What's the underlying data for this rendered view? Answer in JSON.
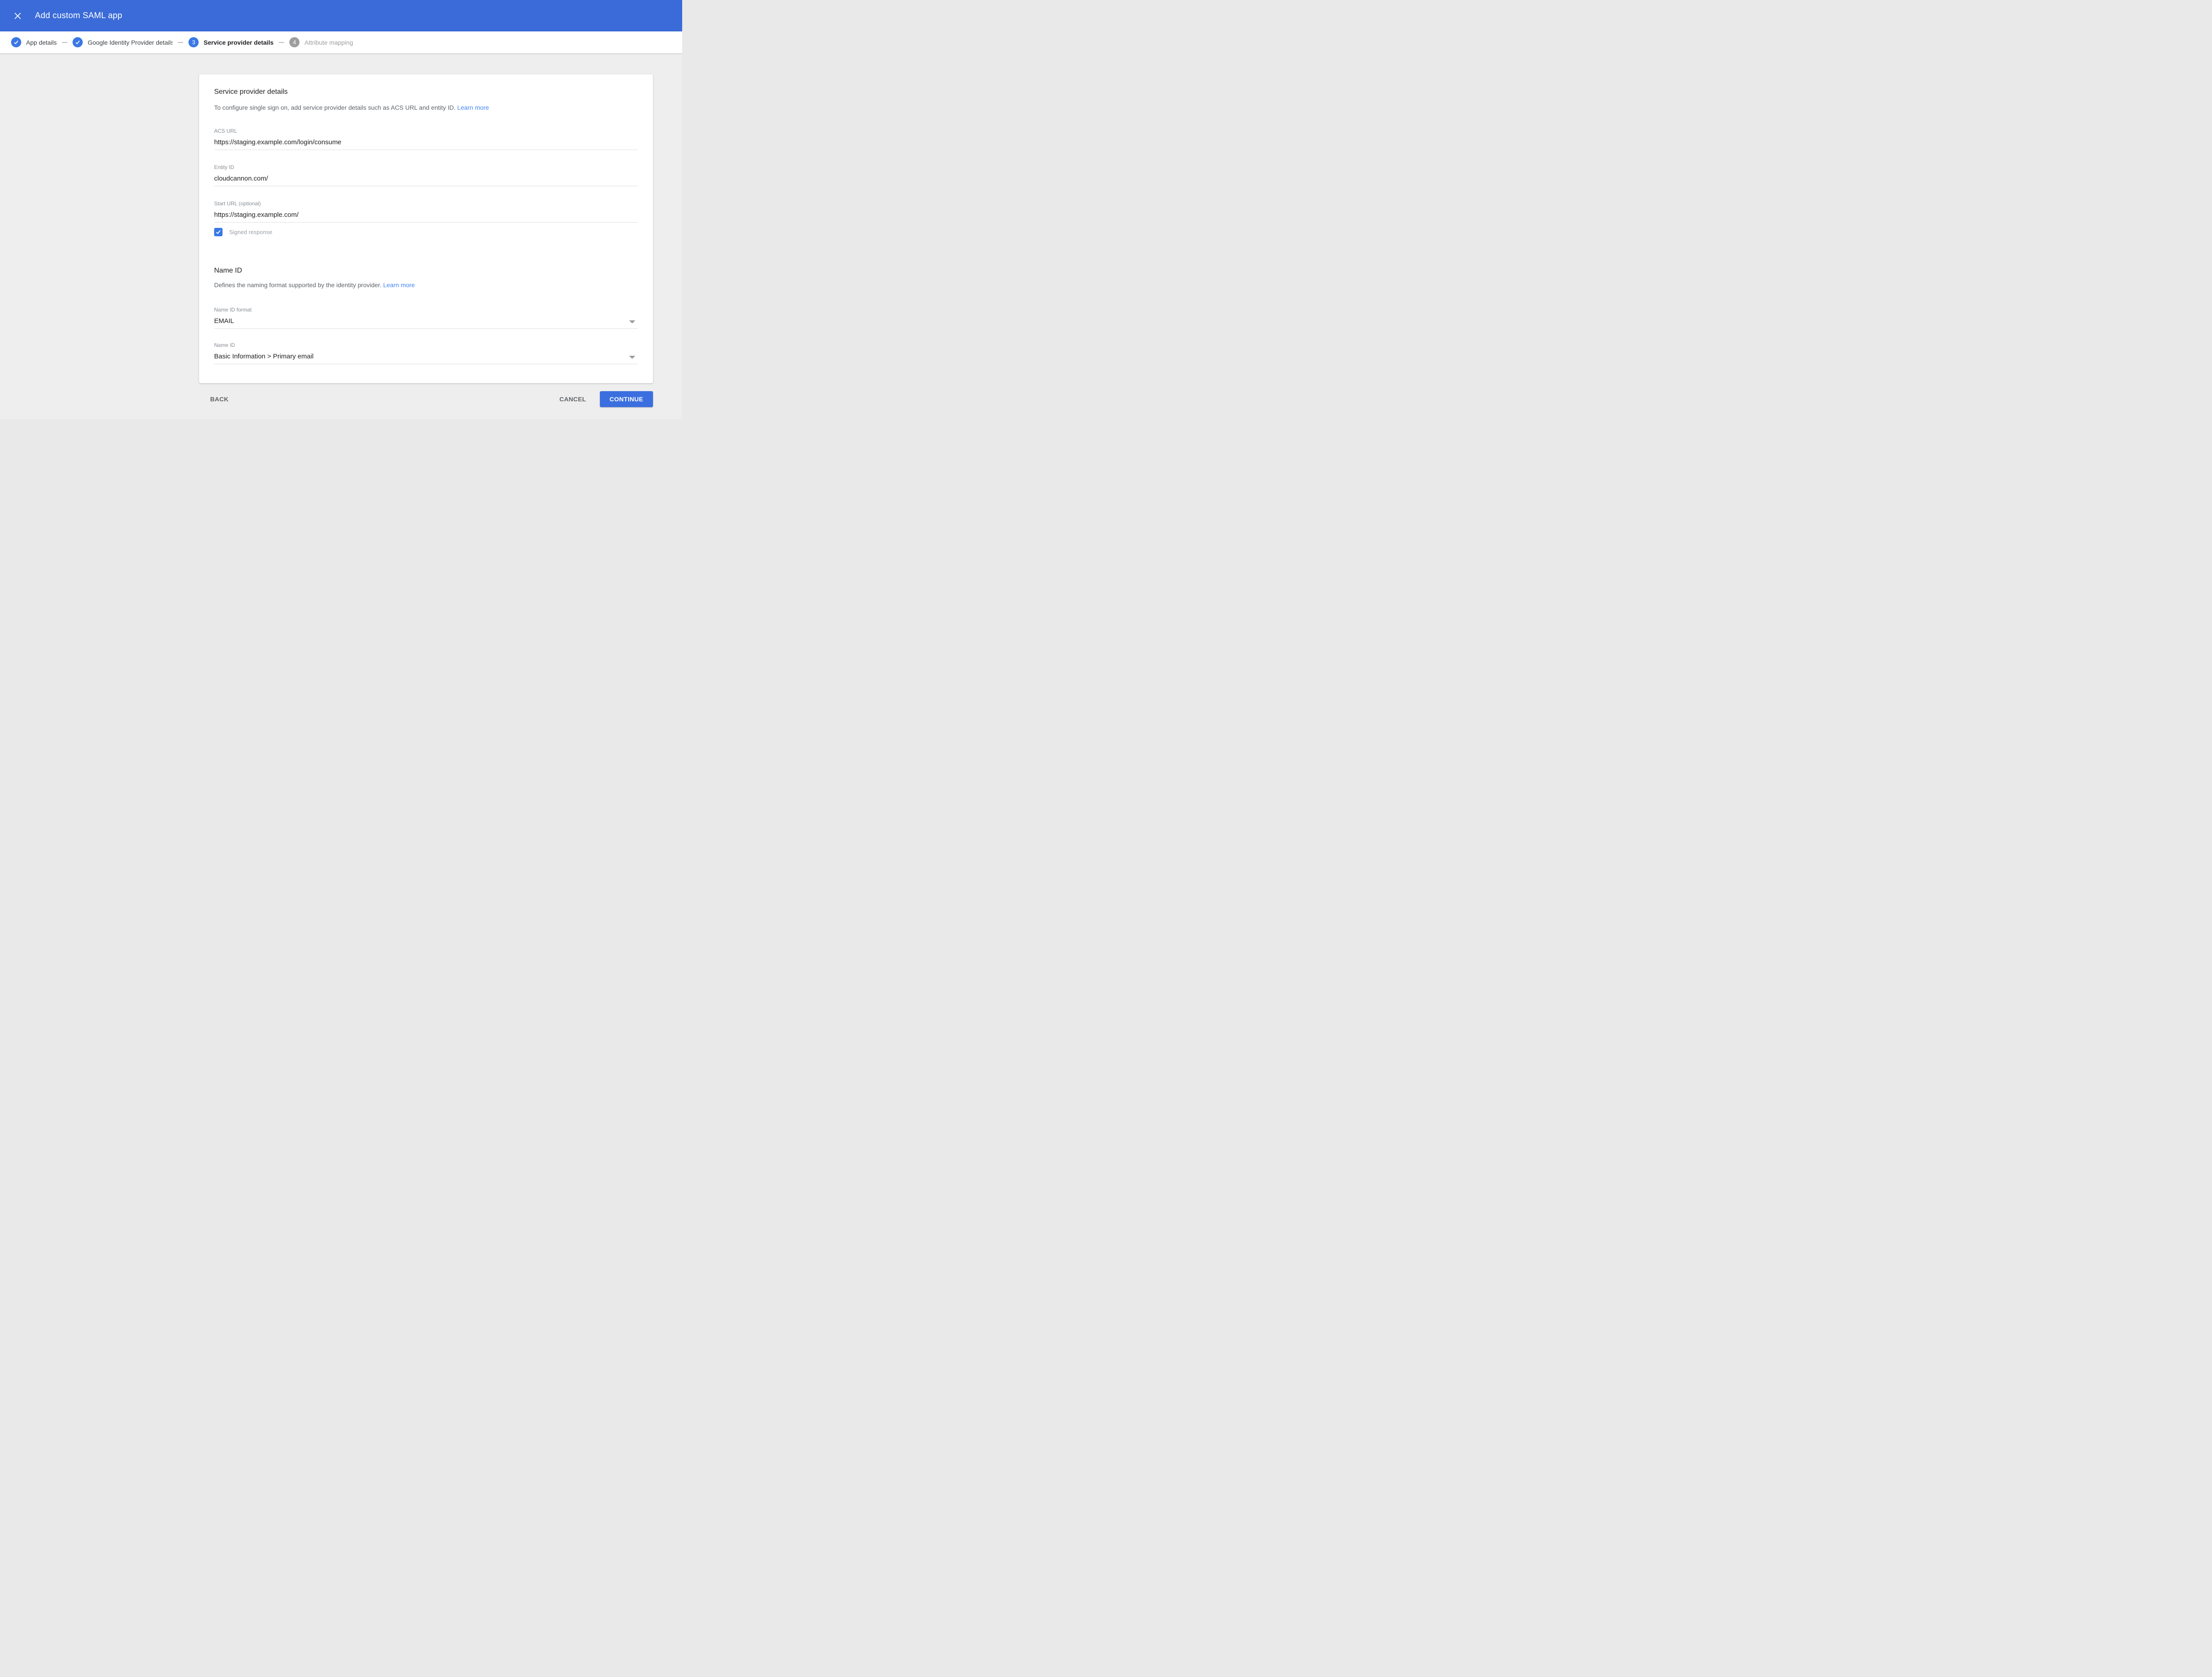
{
  "colors": {
    "topbar_blue": "#3a6bd8",
    "accent_blue": "#3b78e5",
    "continue_blue": "#3b6fe0",
    "link_blue": "#4285f4",
    "background_gray": "#eeeeee"
  },
  "topbar": {
    "title": "Add custom SAML app"
  },
  "stepper": {
    "steps": [
      {
        "label": "App details",
        "state": "complete"
      },
      {
        "label": "Google Identity Provider details",
        "state": "complete"
      },
      {
        "number": "3",
        "label": "Service provider details",
        "state": "current"
      },
      {
        "number": "4",
        "label": "Attribute mapping",
        "state": "upcoming"
      }
    ]
  },
  "service_provider_section": {
    "title": "Service provider details",
    "description": "To configure single sign on, add service provider details such as ACS URL and entity ID.",
    "learn_more_label": "Learn more"
  },
  "fields": {
    "acs_url": {
      "label": "ACS URL",
      "value": "https://staging.example.com/login/consume"
    },
    "entity_id": {
      "label": "Entity ID",
      "value": "cloudcannon.com/"
    },
    "start_url": {
      "label": "Start URL (optional)",
      "value": "https://staging.example.com/"
    },
    "signed_response": {
      "label": "Signed response",
      "checked": true
    }
  },
  "name_id_section": {
    "title": "Name ID",
    "description": "Defines the naming format supported by the identity provider.",
    "learn_more_label": "Learn more"
  },
  "selects": {
    "name_id_format": {
      "label": "Name ID format",
      "value": "EMAIL"
    },
    "name_id": {
      "label": "Name ID",
      "value": "Basic Information > Primary email"
    }
  },
  "footer": {
    "back_label": "BACK",
    "cancel_label": "CANCEL",
    "continue_label": "CONTINUE"
  }
}
